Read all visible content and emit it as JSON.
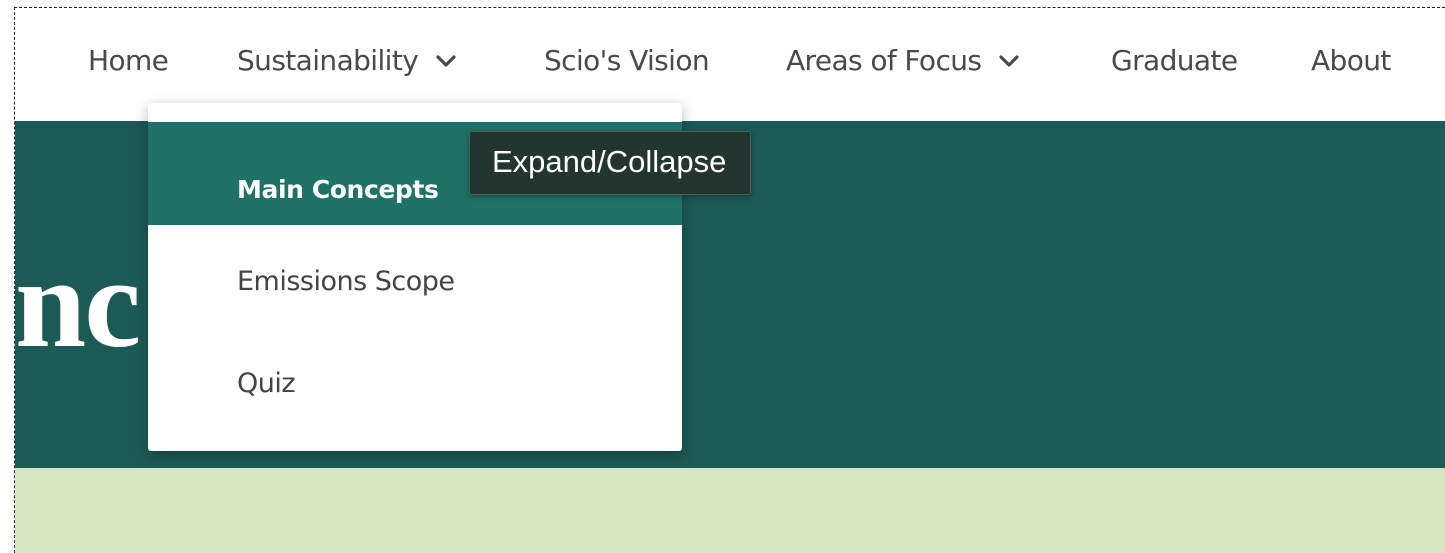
{
  "nav": {
    "items": [
      {
        "label": "Home",
        "has_dropdown": false
      },
      {
        "label": "Sustainability",
        "has_dropdown": true
      },
      {
        "label": "Scio's Vision",
        "has_dropdown": false
      },
      {
        "label": "Areas of Focus",
        "has_dropdown": true
      },
      {
        "label": "Graduate",
        "has_dropdown": false
      },
      {
        "label": "About",
        "has_dropdown": false
      }
    ]
  },
  "hero": {
    "visible_title_fragment": "nc"
  },
  "dropdown": {
    "items": [
      {
        "label": "Main Concepts",
        "active": true
      },
      {
        "label": "Emissions Scope",
        "active": false
      },
      {
        "label": "Quiz",
        "active": false
      }
    ]
  },
  "tooltip": {
    "text": "Expand/Collapse"
  },
  "icons": {
    "dropdown_chevron": "chevron-down-icon"
  },
  "colors": {
    "hero_bg": "#1c5a55",
    "active_item_bg": "#1f7366",
    "band_bg": "#d6e7c4",
    "tooltip_bg": "#23352f"
  }
}
